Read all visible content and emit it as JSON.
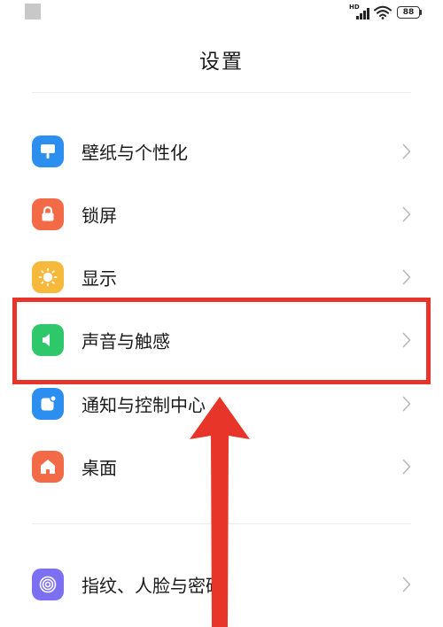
{
  "status_bar": {
    "network_label": "HD",
    "battery_level": "88"
  },
  "page": {
    "title": "设置"
  },
  "settings_items": [
    {
      "label": "壁纸与个性化",
      "icon": "wallpaper-icon",
      "color": "#2c8ff0"
    },
    {
      "label": "锁屏",
      "icon": "lock-icon",
      "color": "#f36a46"
    },
    {
      "label": "显示",
      "icon": "sun-icon",
      "color": "#f6b93b"
    },
    {
      "label": "声音与触感",
      "icon": "speaker-icon",
      "color": "#2ec76a"
    },
    {
      "label": "通知与控制中心",
      "icon": "notification-icon",
      "color": "#2c8ff0"
    },
    {
      "label": "桌面",
      "icon": "home-icon",
      "color": "#f36a46"
    },
    {
      "label": "指纹、人脸与密码",
      "icon": "fingerprint-icon",
      "color": "#7b6ff2"
    }
  ],
  "annotation": {
    "highlight_color": "#e8352a",
    "highlighted_item": "声音与触感"
  }
}
